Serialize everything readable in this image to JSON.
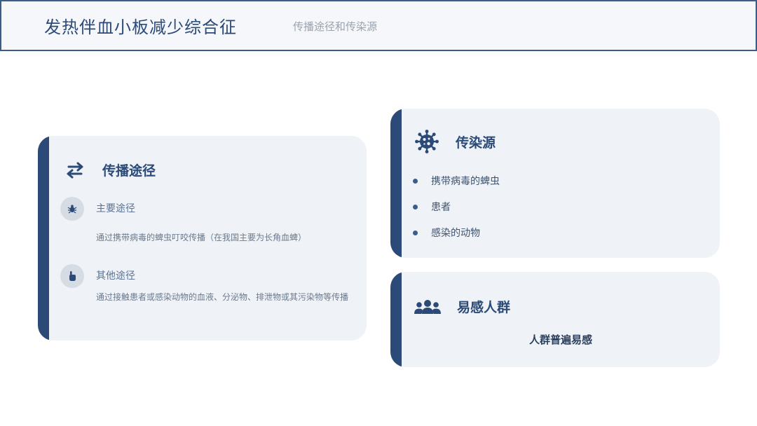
{
  "header": {
    "title": "发热伴血小板减少综合征",
    "subtitle": "传播途径和传染源"
  },
  "transmission": {
    "icon": "arrows-exchange-icon",
    "title": "传播途径",
    "items": [
      {
        "icon": "bug-icon",
        "title": "主要途径",
        "desc": "通过携带病毒的蜱虫叮咬传播（在我国主要为长角血蜱）"
      },
      {
        "icon": "hand-pointer-icon",
        "title": "其他途径",
        "desc": "通过接触患者或感染动物的血液、分泌物、排泄物或其污染物等传播"
      }
    ]
  },
  "source": {
    "icon": "virus-icon",
    "title": "传染源",
    "items": [
      "携带病毒的蜱虫",
      "患者",
      "感染的动物"
    ]
  },
  "susceptible": {
    "icon": "people-group-icon",
    "title": "易感人群",
    "text": "人群普遍易感"
  },
  "colors": {
    "accent": "#2b4a78",
    "card_bg": "#eff2f6",
    "header_bg": "#f5f7fa"
  }
}
